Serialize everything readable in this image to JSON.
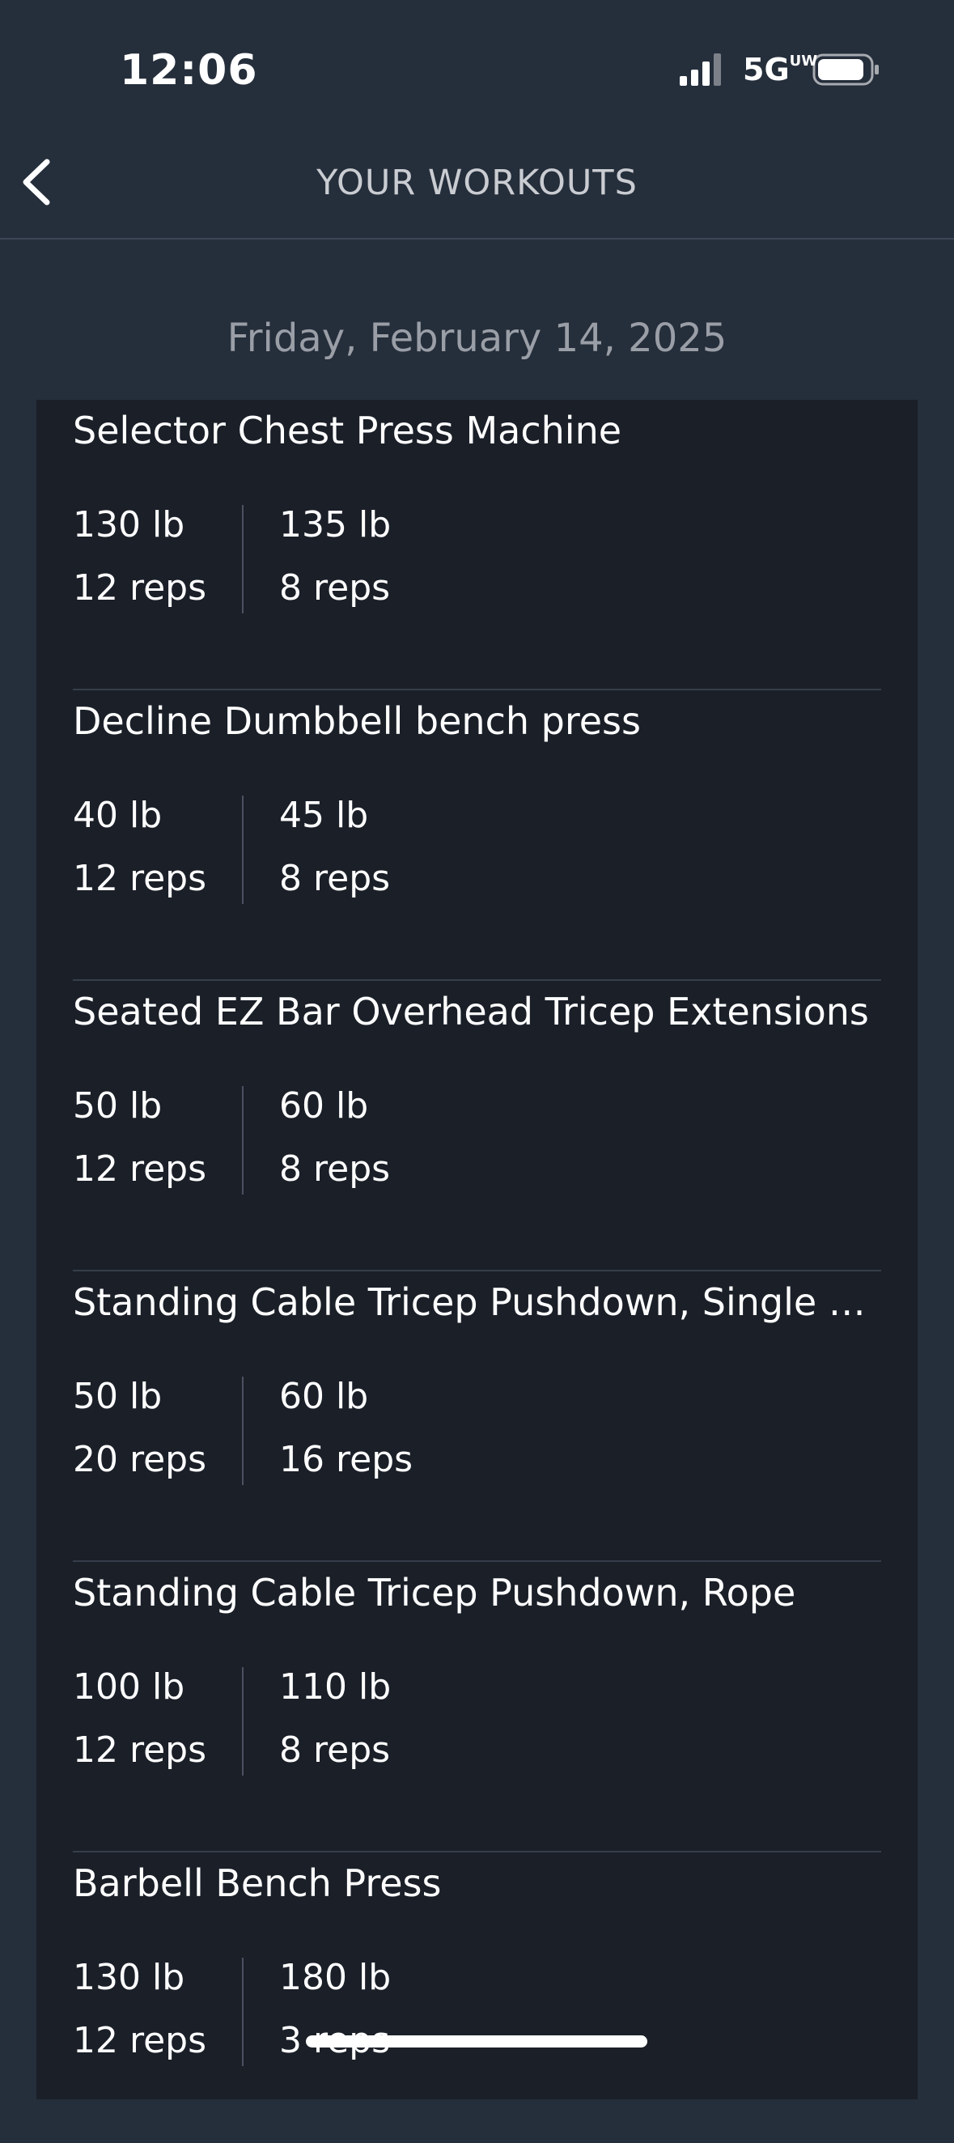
{
  "status_bar": {
    "time": "12:06",
    "network": "5G",
    "network_suffix": "UW",
    "signal_icon": "cellular-signal-icon",
    "battery_icon": "battery-icon"
  },
  "header": {
    "title": "YOUR WORKOUTS",
    "back_icon": "chevron-left-icon"
  },
  "date": "Friday, February 14, 2025",
  "exercises": [
    {
      "name": "Selector Chest Press Machine",
      "sets": [
        {
          "weight": "130 lb",
          "reps": "12 reps"
        },
        {
          "weight": "135 lb",
          "reps": "8 reps"
        }
      ]
    },
    {
      "name": "Decline Dumbbell bench press",
      "sets": [
        {
          "weight": "40 lb",
          "reps": "12 reps"
        },
        {
          "weight": "45 lb",
          "reps": "8 reps"
        }
      ]
    },
    {
      "name": "Seated EZ Bar Overhead Tricep Extensions",
      "sets": [
        {
          "weight": "50 lb",
          "reps": "12 reps"
        },
        {
          "weight": "60 lb",
          "reps": "8 reps"
        }
      ]
    },
    {
      "name": "Standing Cable Tricep Pushdown, Single A…",
      "sets": [
        {
          "weight": "50 lb",
          "reps": "20 reps"
        },
        {
          "weight": "60 lb",
          "reps": "16 reps"
        }
      ]
    },
    {
      "name": "Standing Cable Tricep Pushdown, Rope",
      "sets": [
        {
          "weight": "100 lb",
          "reps": "12 reps"
        },
        {
          "weight": "110 lb",
          "reps": "8 reps"
        }
      ]
    },
    {
      "name": "Barbell Bench Press",
      "sets": [
        {
          "weight": "130 lb",
          "reps": "12 reps"
        },
        {
          "weight": "180 lb",
          "reps": "3 reps"
        }
      ]
    }
  ],
  "colors": {
    "background": "#252e3b",
    "card": "#1a1f28",
    "header_text": "#c9ccd1",
    "date_text": "#9a9ea6"
  }
}
